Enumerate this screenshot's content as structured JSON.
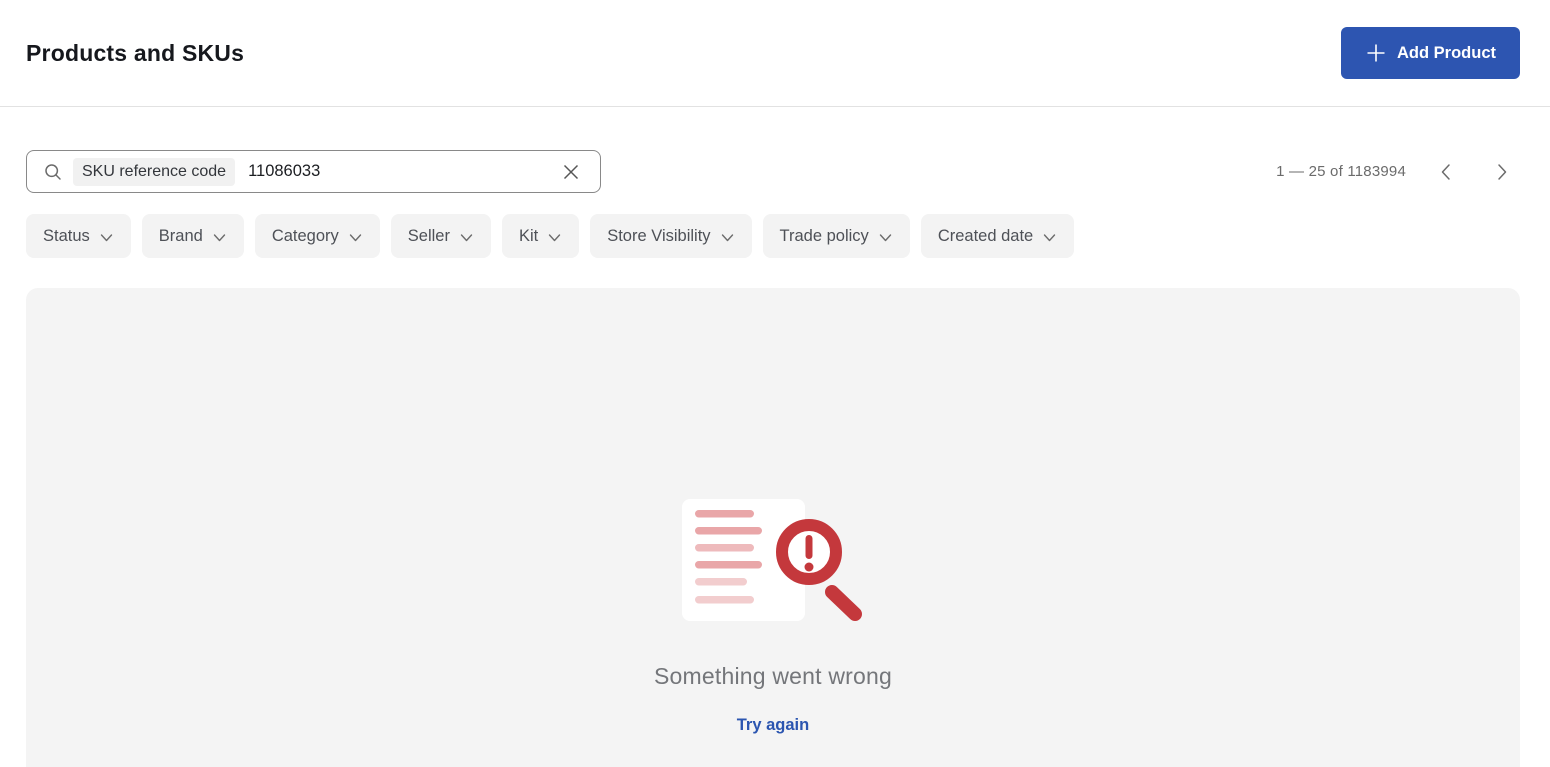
{
  "page": {
    "title": "Products and SKUs"
  },
  "header": {
    "add_product_label": "Add Product"
  },
  "search": {
    "tag_label": "SKU reference code",
    "value": "11086033"
  },
  "pagination": {
    "range_text": "1 — 25 of 1183994"
  },
  "filters": {
    "items": [
      "Status",
      "Brand",
      "Category",
      "Seller",
      "Kit",
      "Store Visibility",
      "Trade policy",
      "Created date"
    ]
  },
  "error_state": {
    "title": "Something went wrong",
    "retry_label": "Try again"
  },
  "colors": {
    "primary_blue": "#2d55b1",
    "link_blue": "#2b55b0",
    "error_red": "#c4383c",
    "doc_line_pink_dark": "#e9a6a8",
    "doc_line_pink_light": "#f2cdce",
    "panel_gray": "#f4f4f4",
    "filter_gray": "#f3f3f3"
  }
}
